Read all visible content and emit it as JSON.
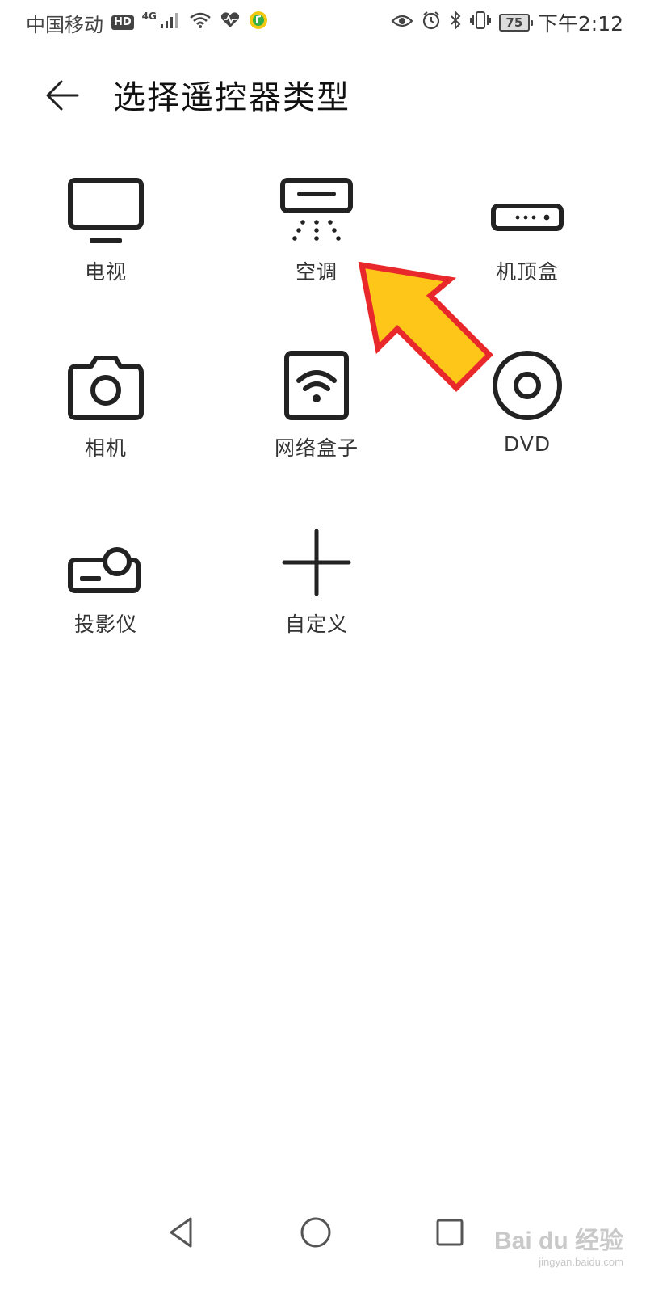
{
  "status_bar": {
    "carrier": "中国移动",
    "hd_badge": "HD",
    "network_type": "4G",
    "battery_level": "75",
    "time": "下午2:12",
    "icons_left": [
      "signal-icon",
      "wifi-icon",
      "health-heart-icon",
      "music-app-icon"
    ],
    "icons_right": [
      "eye-icon",
      "alarm-icon",
      "bluetooth-icon",
      "vibrate-icon",
      "battery-icon"
    ]
  },
  "header": {
    "title": "选择遥控器类型",
    "back_icon": "arrow-left-icon"
  },
  "device_types": [
    {
      "label": "电视",
      "icon": "tv-icon"
    },
    {
      "label": "空调",
      "icon": "air-conditioner-icon"
    },
    {
      "label": "机顶盒",
      "icon": "set-top-box-icon"
    },
    {
      "label": "相机",
      "icon": "camera-icon"
    },
    {
      "label": "网络盒子",
      "icon": "network-box-icon"
    },
    {
      "label": "DVD",
      "icon": "disc-icon"
    },
    {
      "label": "投影仪",
      "icon": "projector-icon"
    },
    {
      "label": "自定义",
      "icon": "plus-icon"
    }
  ],
  "annotation": {
    "type": "arrow",
    "fill_color": "#FFC61A",
    "stroke_color": "#E8282B",
    "points_to": "空调"
  },
  "nav_bar": {
    "icons": [
      "back-triangle-icon",
      "home-circle-icon",
      "recents-square-icon"
    ]
  },
  "watermark": {
    "logo_text": "Bai du 经验",
    "url": "jingyan.baidu.com"
  },
  "colors": {
    "background": "#FFFFFF",
    "text_primary": "#111111",
    "text_secondary": "#333333",
    "status_text": "#444444"
  }
}
